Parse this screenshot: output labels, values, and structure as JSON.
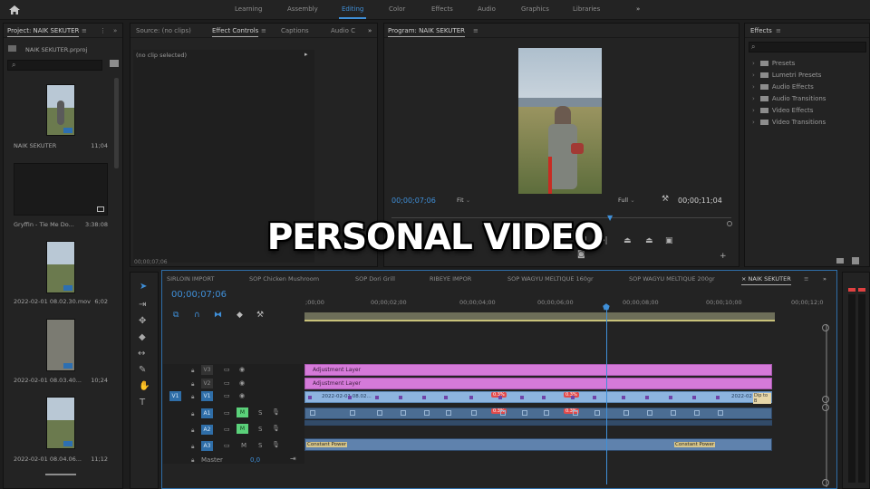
{
  "overlay_title": "PERSONAL VIDEO",
  "workspaces": [
    {
      "label": "Learning"
    },
    {
      "label": "Assembly"
    },
    {
      "label": "Editing"
    },
    {
      "label": "Color"
    },
    {
      "label": "Effects"
    },
    {
      "label": "Audio"
    },
    {
      "label": "Graphics"
    },
    {
      "label": "Libraries"
    }
  ],
  "workspace_more": "»",
  "project": {
    "tab": "Project: NAIK SEKUTER",
    "menu": "≡",
    "more": "»",
    "file": "NAIK SEKUTER.prproj",
    "items": [
      {
        "name": "NAIK SEKUTER",
        "duration": "11;04"
      },
      {
        "name": "Gryffin - Tie Me Do...",
        "duration": "3:38:08"
      },
      {
        "name": "2022-02-01 08.02.30.mov",
        "duration": "6;02"
      },
      {
        "name": "2022-02-01 08.03.40...",
        "duration": "10;24"
      },
      {
        "name": "2022-02-01 08.04.06...",
        "duration": "11;12"
      }
    ]
  },
  "source_panel": {
    "tabs": [
      {
        "label": "Source: (no clips)"
      },
      {
        "label": "Effect Controls"
      },
      {
        "label": "Captions"
      },
      {
        "label": "Audio C"
      }
    ],
    "menu": "≡",
    "more": "»",
    "no_clip": "(no clip selected)",
    "play_arrow": "▸",
    "timecode": "00;00;07;06"
  },
  "program": {
    "tab": "Program: NAIK SEKUTER",
    "menu": "≡",
    "timecode_current": "00;00;07;06",
    "fit": "Fit",
    "quality": "Full",
    "timecode_total": "00;00;11;04"
  },
  "effects": {
    "tab": "Effects",
    "menu": "≡",
    "items": [
      {
        "label": "Presets"
      },
      {
        "label": "Lumetri Presets"
      },
      {
        "label": "Audio Effects"
      },
      {
        "label": "Audio Transitions"
      },
      {
        "label": "Video Effects"
      },
      {
        "label": "Video Transitions"
      }
    ]
  },
  "timeline": {
    "sequences": [
      {
        "label": "SIRLOIN IMPORT"
      },
      {
        "label": "SOP Chicken Mushroom"
      },
      {
        "label": "SOP Dori Grill"
      },
      {
        "label": "RIBEYE IMPOR"
      },
      {
        "label": "SOP WAGYU MELTIQUE 160gr"
      },
      {
        "label": "SOP WAGYU MELTIQUE 200gr"
      },
      {
        "label": "× NAIK SEKUTER"
      }
    ],
    "active_sequence_menu": "≡",
    "timecode": "00;00;07;06",
    "ruler": [
      {
        "label": ";00;00"
      },
      {
        "label": "00;00;02;00"
      },
      {
        "label": "00;00;04;00"
      },
      {
        "label": "00;00;06;00"
      },
      {
        "label": "00;00;08;00"
      },
      {
        "label": "00;00;10;00"
      },
      {
        "label": "00;00;12;0"
      }
    ],
    "tracks": {
      "v3": "V3",
      "v2": "V2",
      "v1": "V1",
      "v1_src": "V1",
      "a1": "A1",
      "a1_src": "A1",
      "a2": "A2",
      "a3": "A3",
      "m": "M",
      "s": "S",
      "master": "Master",
      "master_value": "0,0"
    },
    "clips": {
      "adj1": "Adjustment Layer",
      "adj2": "Adjustment Layer",
      "v1_name": "2022-02-01 08.02...",
      "v1_tail": "2022-02",
      "v1_tail2": "Dip to B",
      "red1": "0.3%",
      "red2": "0.3%",
      "red3": "0.3%",
      "red4": "0.3%",
      "a3_left": "Constant Power",
      "a3_right": "Constant Power"
    },
    "playhead_fraction": 0.6
  },
  "colors": {
    "accent": "#3f8fd8",
    "adjustment": "#d57ad9",
    "video_clip": "#8db4df",
    "audio_clip": "#4b6d93",
    "meter_red": "#e04040"
  }
}
